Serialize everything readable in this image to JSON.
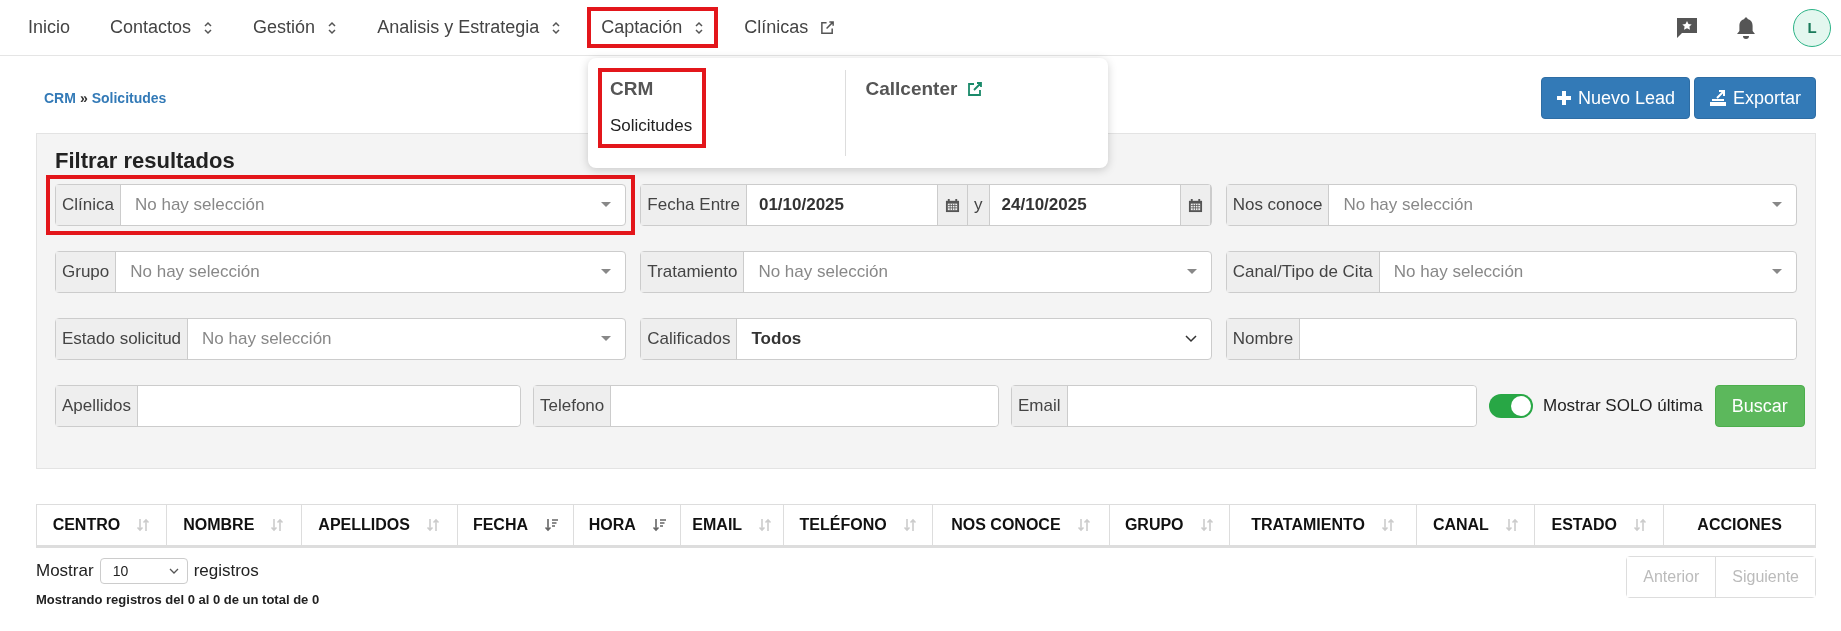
{
  "nav": {
    "items": [
      {
        "label": "Inicio",
        "kind": "link",
        "highlighted": false
      },
      {
        "label": "Contactos",
        "kind": "menu",
        "highlighted": false
      },
      {
        "label": "Gestión",
        "kind": "menu",
        "highlighted": false
      },
      {
        "label": "Analisis y Estrategia",
        "kind": "menu",
        "highlighted": false
      },
      {
        "label": "Captación",
        "kind": "menu",
        "highlighted": true
      },
      {
        "label": "Clínicas",
        "kind": "external",
        "highlighted": false
      }
    ],
    "avatar": "L"
  },
  "dropdown": {
    "groups": [
      {
        "title": "CRM",
        "external": false,
        "highlighted": true,
        "links": [
          "Solicitudes"
        ]
      },
      {
        "title": "Callcenter",
        "external": true,
        "highlighted": false
      }
    ]
  },
  "breadcrumb": {
    "items": [
      "CRM",
      "Solicitudes"
    ],
    "separator": "»"
  },
  "actions": [
    {
      "label": "Nuevo Lead"
    },
    {
      "label": "Exportar"
    }
  ],
  "filters": {
    "title": "Filtrar resultados",
    "rows": [
      {
        "items": [
          {
            "kind": "select",
            "label": "Clínica",
            "placeholder": "No hay selección",
            "highlighted": true
          },
          {
            "kind": "daterange",
            "label": "Fecha Entre",
            "from": "01/10/2025",
            "separator": "y",
            "to": "24/10/2025"
          },
          {
            "kind": "select",
            "label": "Nos conoce",
            "placeholder": "No hay selección",
            "highlighted": false
          }
        ]
      },
      {
        "items": [
          {
            "kind": "select",
            "label": "Grupo",
            "placeholder": "No hay selección",
            "highlighted": false
          },
          {
            "kind": "select",
            "label": "Tratamiento",
            "placeholder": "No hay selección",
            "highlighted": false
          },
          {
            "kind": "select",
            "label": "Canal/Tipo de Cita",
            "placeholder": "No hay selección",
            "highlighted": false
          }
        ]
      },
      {
        "items": [
          {
            "kind": "select",
            "label": "Estado solicitud",
            "placeholder": "No hay selección",
            "highlighted": false
          },
          {
            "kind": "native",
            "label": "Calificados",
            "value": "Todos"
          },
          {
            "kind": "text",
            "label": "Nombre"
          }
        ]
      },
      {
        "items": [
          {
            "kind": "text",
            "label": "Apellidos"
          },
          {
            "kind": "text",
            "label": "Telefono"
          },
          {
            "kind": "text",
            "label": "Email"
          },
          {
            "kind": "toggle",
            "label": "Mostrar SOLO última",
            "on": true
          },
          {
            "kind": "button",
            "label": "Buscar"
          }
        ]
      }
    ]
  },
  "table": {
    "columns": [
      {
        "label": "CENTRO",
        "sortable": true,
        "sorted": false
      },
      {
        "label": "NOMBRE",
        "sortable": true,
        "sorted": false
      },
      {
        "label": "APELLIDOS",
        "sortable": true,
        "sorted": false
      },
      {
        "label": "FECHA",
        "sortable": true,
        "sorted": true
      },
      {
        "label": "HORA",
        "sortable": true,
        "sorted": true
      },
      {
        "label": "EMAIL",
        "sortable": true,
        "sorted": false
      },
      {
        "label": "TELÉFONO",
        "sortable": true,
        "sorted": false
      },
      {
        "label": "NOS CONOCE",
        "sortable": true,
        "sorted": false
      },
      {
        "label": "GRUPO",
        "sortable": true,
        "sorted": false
      },
      {
        "label": "TRATAMIENTO",
        "sortable": true,
        "sorted": false
      },
      {
        "label": "CANAL",
        "sortable": true,
        "sorted": false
      },
      {
        "label": "ESTADO",
        "sortable": true,
        "sorted": false
      },
      {
        "label": "ACCIONES",
        "sortable": false
      }
    ]
  },
  "length": {
    "before": "Mostrar",
    "value": "10",
    "after": "registros"
  },
  "pagination": [
    {
      "label": "Anterior",
      "disabled": true
    },
    {
      "label": "Siguiente",
      "disabled": true
    }
  ],
  "info": "Mostrando registros del 0 al 0 de un total de 0"
}
